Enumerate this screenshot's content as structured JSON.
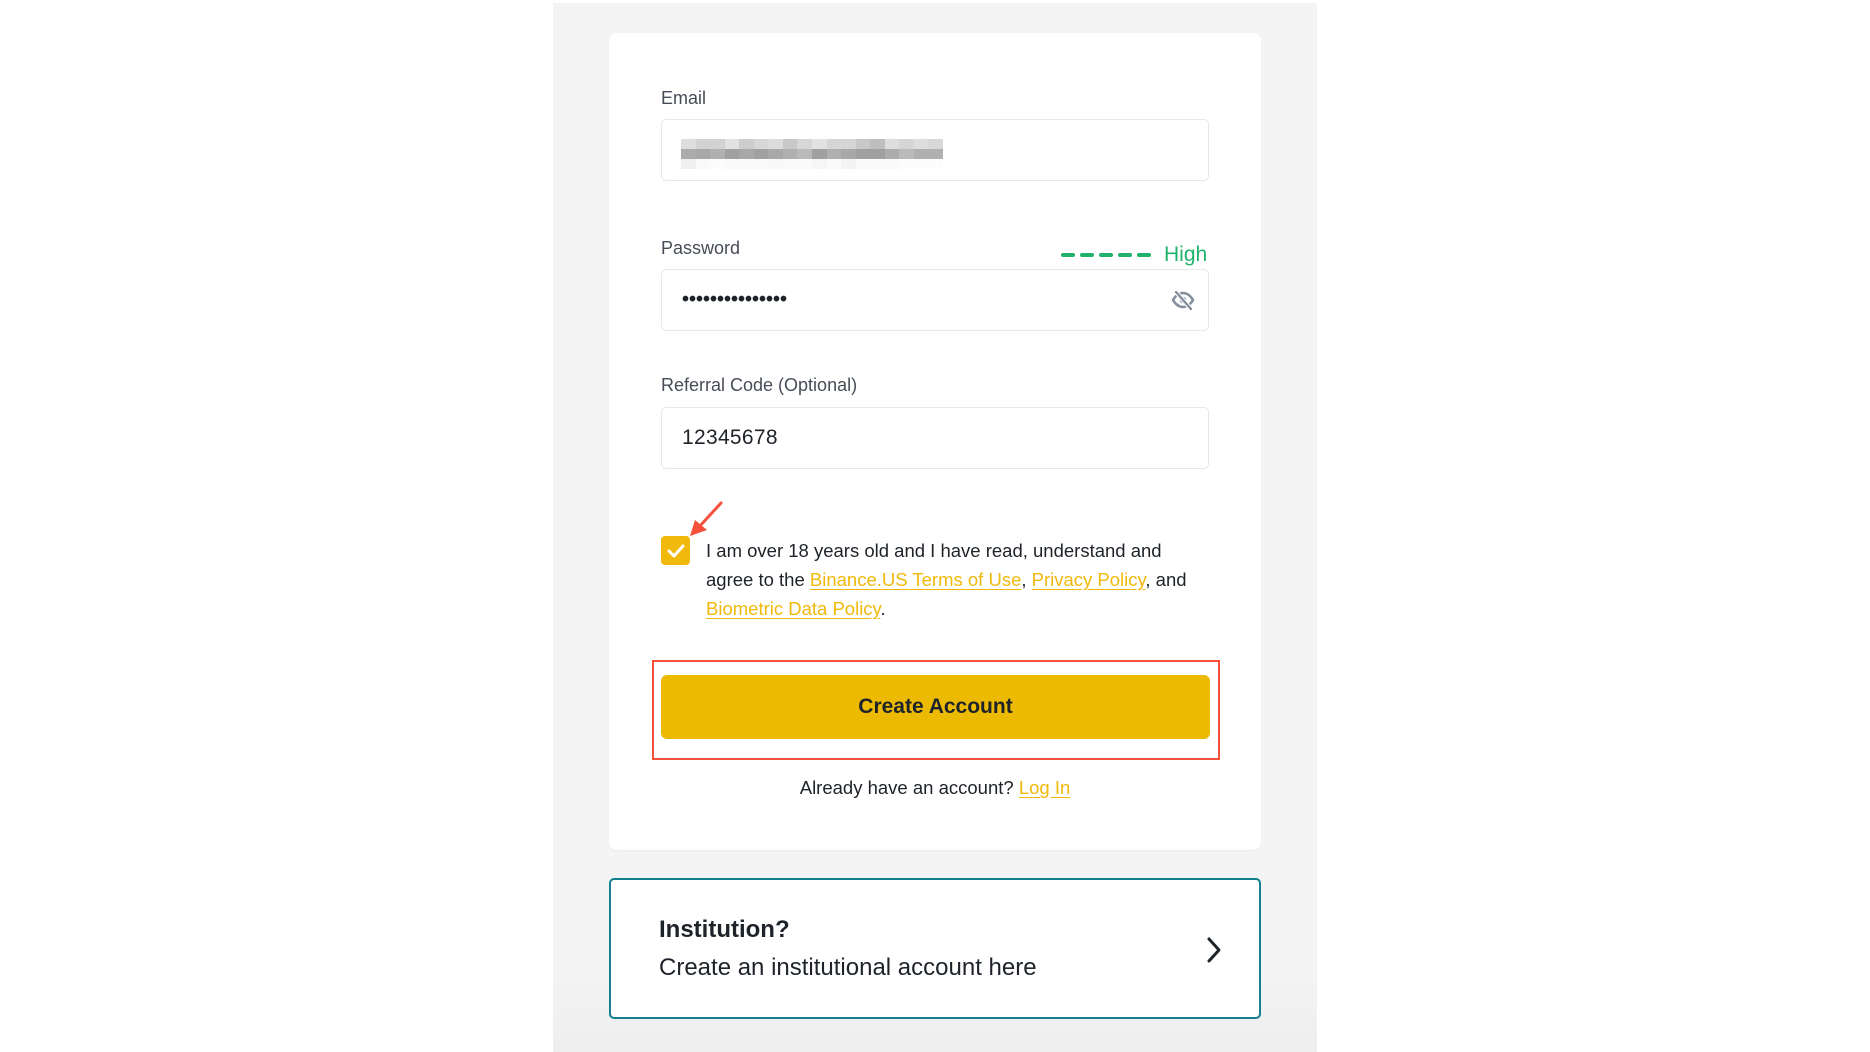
{
  "form": {
    "email": {
      "label": "Email",
      "value_blurred": true
    },
    "password": {
      "label": "Password",
      "masked_value": "•••••••••••••••",
      "strength": {
        "label": "High",
        "segments_filled": 5,
        "segments_total": 5,
        "color": "#20B26C"
      },
      "toggle_icon": "eye-slash-icon"
    },
    "referral": {
      "label": "Referral Code (Optional)",
      "value": "12345678"
    },
    "agreement": {
      "checked": true,
      "text_prefix": "I am over 18 years old and I have read, understand and agree to the ",
      "link_terms": "Binance.US Terms of Use",
      "separator_1": ", ",
      "link_privacy": "Privacy Policy",
      "separator_2": ", and ",
      "link_biometric": "Biometric Data Policy",
      "text_suffix": "."
    },
    "create_button_label": "Create Account",
    "login_prompt": "Already have an account? ",
    "login_link": "Log In"
  },
  "institution": {
    "title": "Institution?",
    "subtitle": "Create an institutional account here",
    "icon": "chevron-right-icon"
  },
  "annotations": {
    "arrow_color": "#F4503C",
    "highlight_color": "#F4503C"
  },
  "colors": {
    "brand_yellow": "#F0B90B",
    "button_yellow": "#EDBA02",
    "teal_border": "#12808F",
    "text": "#1E2329",
    "label": "#474D57"
  }
}
